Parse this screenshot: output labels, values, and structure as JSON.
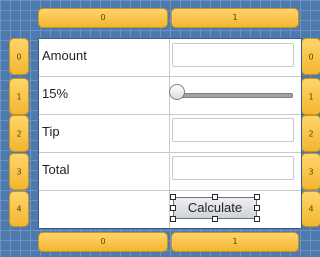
{
  "columns": {
    "top": [
      "0",
      "1"
    ],
    "bottom": [
      "0",
      "1"
    ]
  },
  "rows": {
    "left": [
      "0",
      "1",
      "2",
      "3",
      "4"
    ],
    "right": [
      "0",
      "1",
      "2",
      "3",
      "4"
    ]
  },
  "form": {
    "amount_label": "Amount",
    "amount_value": "",
    "tip_percent_label": "15%",
    "tip_percent_slider_value": 0.0,
    "tip_label": "Tip",
    "tip_value": "",
    "total_label": "Total",
    "total_value": "",
    "calculate_label": "Calculate"
  },
  "colors": {
    "canvas": "#4d79ad",
    "ruler": "#f2b630",
    "panel": "#ffffff"
  }
}
